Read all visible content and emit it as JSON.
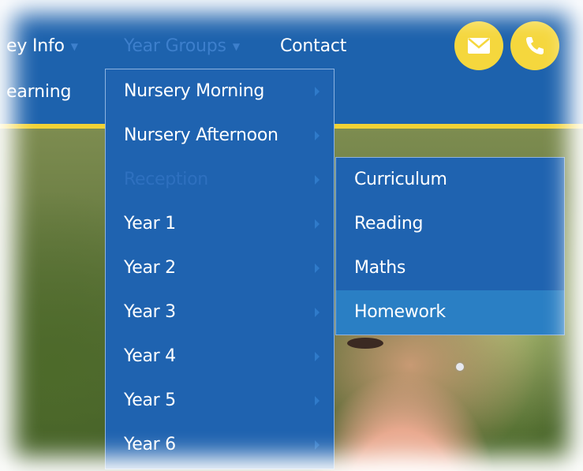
{
  "nav": {
    "key_info_label": "ey Info",
    "year_groups_label": "Year Groups",
    "contact_label": "Contact",
    "learning_label": "earning"
  },
  "buttons": {
    "email_icon": "envelope-icon",
    "phone_icon": "phone-icon"
  },
  "year_groups_menu": {
    "items": [
      {
        "label": "Nursery Morning"
      },
      {
        "label": "Nursery Afternoon"
      },
      {
        "label": "Reception"
      },
      {
        "label": "Year 1"
      },
      {
        "label": "Year 2"
      },
      {
        "label": "Year 3"
      },
      {
        "label": "Year 4"
      },
      {
        "label": "Year 5"
      },
      {
        "label": "Year 6"
      }
    ],
    "active_index": 2
  },
  "reception_submenu": {
    "items": [
      {
        "label": "Curriculum"
      },
      {
        "label": "Reading"
      },
      {
        "label": "Maths"
      },
      {
        "label": "Homework"
      }
    ],
    "hover_index": 3
  },
  "colors": {
    "header_blue": "#1d62ad",
    "accent_yellow": "#f2d335",
    "menu_blue": "#1f63b0",
    "hover_blue": "#2a7fc4"
  }
}
